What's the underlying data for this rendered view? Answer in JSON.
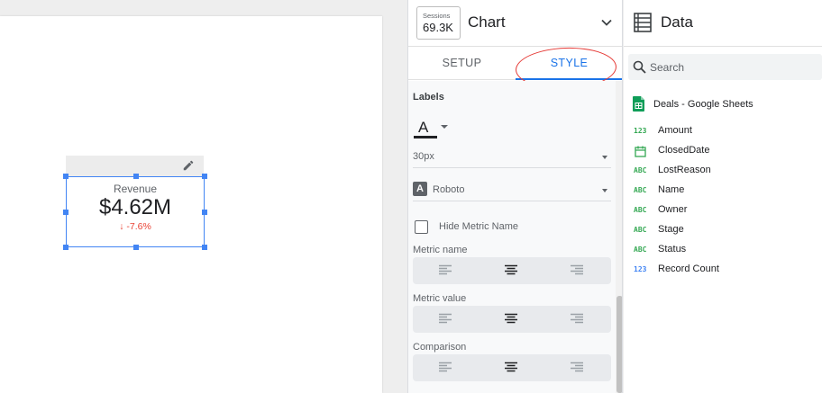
{
  "scorecard": {
    "title": "Revenue",
    "value": "$4.62M",
    "delta": "↓ -7.6%"
  },
  "properties": {
    "thumb_label": "Sessions",
    "thumb_value": "69.3K",
    "chart_type": "Chart",
    "tabs": [
      {
        "label": "SETUP"
      },
      {
        "label": "STYLE"
      }
    ],
    "active_tab": "STYLE",
    "style": {
      "section_title": "Labels",
      "font_size": "30px",
      "font_family": "Roboto",
      "hide_metric_name_label": "Hide Metric Name",
      "hide_metric_name_checked": false,
      "metric_name_label": "Metric name",
      "metric_value_label": "Metric value",
      "comparison_label": "Comparison",
      "alignment_selected": "center"
    }
  },
  "data_panel": {
    "title": "Data",
    "search_placeholder": "Search",
    "source_name": "Deals - Google Sheets",
    "fields": [
      {
        "type": "123",
        "name": "Amount",
        "color": "#34a853"
      },
      {
        "type": "date",
        "name": "ClosedDate",
        "color": "#34a853"
      },
      {
        "type": "ABC",
        "name": "LostReason",
        "color": "#34a853"
      },
      {
        "type": "ABC",
        "name": "Name",
        "color": "#34a853"
      },
      {
        "type": "ABC",
        "name": "Owner",
        "color": "#34a853"
      },
      {
        "type": "ABC",
        "name": "Stage",
        "color": "#34a853"
      },
      {
        "type": "ABC",
        "name": "Status",
        "color": "#34a853"
      },
      {
        "type": "123",
        "name": "Record Count",
        "color": "#4285f4"
      }
    ]
  },
  "colors": {
    "accent": "#1a73e8",
    "selection": "#4285f4",
    "negative": "#ea4335",
    "annotation": "#e53935",
    "sheets_green": "#0f9d58"
  }
}
